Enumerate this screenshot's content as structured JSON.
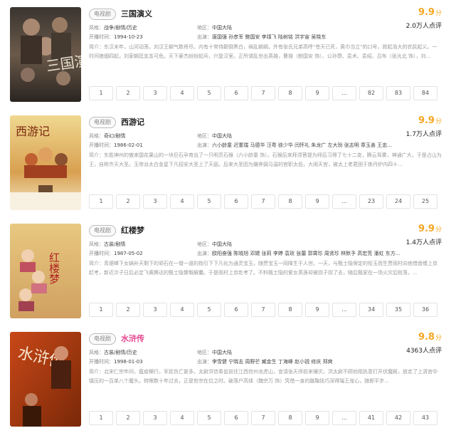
{
  "cards": [
    {
      "tag": "电视剧",
      "title": "三国演义",
      "score": "9.9",
      "score_unit": "分",
      "votes": "2.0万人点评",
      "genre_label": "风格：",
      "genre": "战争/剧情/历史",
      "region_label": "地区：",
      "region": "中国大陆",
      "date_label": "开播时间：",
      "date": "1994-10-23",
      "cast_label": "出演：",
      "cast": "唐国强 孙彦军 鲍国安 李靖飞 陆树铭 洪宇宙 吴晓东",
      "intro": "简介：东汉末年，山河动荡，刘汉王朝气数将尽。内有十常侍颠倒黑白，祸乱朝纲。外有张氏兄弟高呼\"苍天已死，黄巾当立\"的口号，掀起浩大的农民起义。一时间狼烟四起，刘家朝廷岌岌可危。天下豪杰纷纷起兵，兴复汉室。正所谓乱世出英雄，曹操（鲍国安 饰）、公孙瓒、袁术、袁绍、吕布（张光北 饰），刘...",
      "pages": [
        "1",
        "2",
        "3",
        "4",
        "5",
        "6",
        "7",
        "8",
        "9",
        "...",
        "82",
        "83",
        "84"
      ],
      "poster_text": "三国演义"
    },
    {
      "tag": "电视剧",
      "title": "西游记",
      "score": "9.9",
      "score_unit": "分",
      "votes": "1.7万人点评",
      "genre_label": "风格：",
      "genre": "奇幻/剧情",
      "region_label": "地区：",
      "region": "中国大陆",
      "date_label": "开播时间：",
      "date": "1986-02-01",
      "cast_label": "出演：",
      "cast": "六小龄童 迟重瑞 马德华 汪粤 徐少华 闫怀礼 朱龙广 左大玢 张志明 章玉善 王忠...",
      "intro": "简介：东胜神州的傲来国花果山的一块巨石孕育出了一只明灵石猴（六小龄童 饰）。石猴后来拜须菩提为师后习得了七十二变，腾云驾雾，神通广大，于是占山为王，自称齐天大圣。玉帝派太白金星下凡招安大圣上了天庭。后来大圣因为嫌弃弼马温的官职太低，大闹天宫，被太上老君困于炼丹炉内四十...",
      "pages": [
        "1",
        "2",
        "3",
        "4",
        "5",
        "6",
        "7",
        "8",
        "9",
        "...",
        "23",
        "24",
        "25"
      ],
      "poster_text": "西游记"
    },
    {
      "tag": "电视剧",
      "title": "红楼梦",
      "score": "9.9",
      "score_unit": "分",
      "votes": "1.4万人点评",
      "genre_label": "风格：",
      "genre": "古装/剧情",
      "region_label": "地区：",
      "region": "中国大陆",
      "date_label": "开播时间：",
      "date": "1987-05-02",
      "cast_label": "出演：",
      "cast": "欧阳奋强 陈晓旭 邓婕 张莉 李婷 袁玫 张蕾 郭霄珍 周贤珍 林默予 高宏亮 潘虹 东方...",
      "intro": "简介：青埂峰下女娲补天剩下的顽石在一僧一道的指引下下凡化为通灵宝玉，随贾宝玉一同降生于人世。一天，与甄士隐保定的衔玉而生贾雨村向他借盘缠上京赶考，新近次子日后必定飞黄腾达的甄士隐慷慨解囊。于是雨村上京赴考了。不料甄士隐的爱女英莲却被拐子拐了去，随后甄家在一场火灾后败落，...",
      "pages": [
        "1",
        "2",
        "3",
        "4",
        "5",
        "6",
        "7",
        "8",
        "9",
        "...",
        "34",
        "35",
        "36"
      ],
      "poster_text": "红楼梦"
    },
    {
      "tag": "电视剧",
      "title": "水浒传",
      "score": "9.8",
      "score_unit": "分",
      "votes": "4363人点评",
      "genre_label": "风格：",
      "genre": "古装/剧情/历史",
      "region_label": "地区：",
      "region": "中国大陆",
      "date_label": "开播时间：",
      "date": "1998-01-03",
      "cast_label": "出演：",
      "cast": "李雪健 宁晓志 周野芒 臧金生 丁海峰 赵小锐 修庆 郑爽",
      "intro": "简介：北宋仁宗年间，瘟疫横行，军民伤亡甚多。太尉洪信奉旨前往江西信州龙虎山，宣请张天师前来禳灾。洪太尉不顾劝阻执意打开伏魔殿，放走了上清宫中镇压的一百单八个魔头。转眼数十年过去，正是哲宗在位之时。破落户高俅（魏宗万 饰）凭借一身的蹴鞠技巧深得端王宠心，随即平步...",
      "pages": [
        "1",
        "2",
        "3",
        "4",
        "5",
        "6",
        "7",
        "8",
        "9",
        "...",
        "41",
        "42",
        "43"
      ],
      "poster_text": "水浒传"
    }
  ]
}
